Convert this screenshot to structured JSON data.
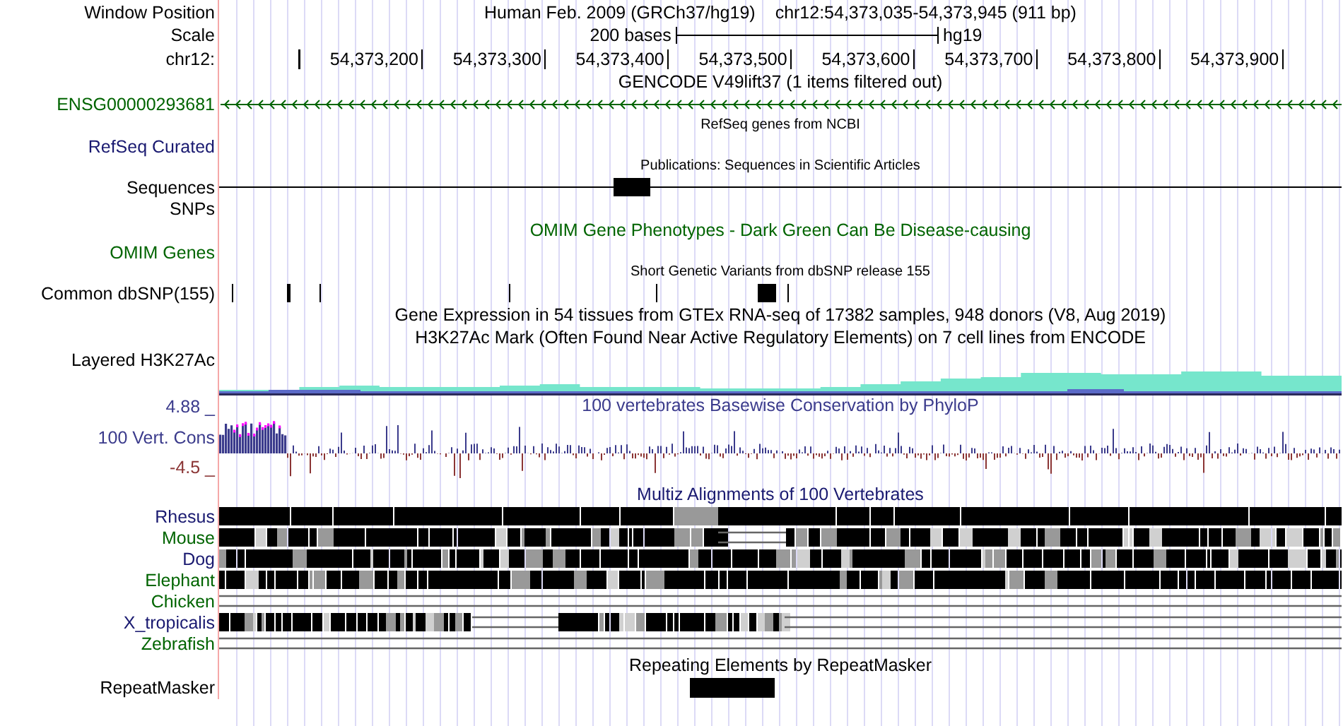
{
  "header": {
    "position_label": "Window Position",
    "title": "Human Feb. 2009 (GRCh37/hg19)",
    "position": "chr12:54,373,035-54,373,945 (911 bp)",
    "scale_label": "Scale",
    "scale_text": "200 bases",
    "assembly": "hg19",
    "ruler_label": "chr12:",
    "ruler_ticks": [
      "54,373,200",
      "54,373,300",
      "54,373,400",
      "54,373,500",
      "54,373,600",
      "54,373,700",
      "54,373,800",
      "54,373,900"
    ]
  },
  "rows": [
    {
      "kind": "caption",
      "text": "GENCODE V49lift37 (1 items filtered out)",
      "color": "#000000"
    },
    {
      "kind": "gene",
      "label": "ENSG00000293681",
      "color": "#006400"
    },
    {
      "kind": "note",
      "text": "RefSeq genes from NCBI"
    },
    {
      "kind": "empty",
      "label": "RefSeq Curated",
      "color": "#191970"
    },
    {
      "kind": "note",
      "text": "Publications: Sequences in Scientific Articles"
    },
    {
      "kind": "sequence",
      "label": "Sequences",
      "color": "#000000"
    },
    {
      "kind": "empty",
      "label": "SNPs",
      "color": "#000000"
    },
    {
      "kind": "caption",
      "text": "OMIM Gene Phenotypes - Dark Green Can Be Disease-causing",
      "color": "#006400"
    },
    {
      "kind": "empty",
      "label": "OMIM Genes",
      "color": "#006400"
    },
    {
      "kind": "note",
      "text": "Short Genetic Variants from dbSNP release 155"
    },
    {
      "kind": "snps",
      "label": "Common dbSNP(155)",
      "color": "#000000"
    },
    {
      "kind": "caption",
      "text": "Gene Expression in 54 tissues from GTEx RNA-seq of 17382 samples, 948 donors (V8, Aug 2019)",
      "color": "#000000"
    },
    {
      "kind": "caption",
      "text": "H3K27Ac Mark (Often Found Near Active Regulatory Elements) on 7 cell lines from ENCODE",
      "color": "#000000"
    },
    {
      "kind": "empty",
      "label": "Layered H3K27Ac",
      "color": "#000000"
    },
    {
      "kind": "layered"
    },
    {
      "kind": "conservation",
      "top": "4.88 _",
      "label": "100 Vert. Cons",
      "bottom": "-4.5 _",
      "text": "100 vertebrates Basewise Conservation by PhyloP"
    },
    {
      "kind": "caption",
      "text": "Multiz Alignments of 100 Vertebrates",
      "color": "#191970"
    },
    {
      "kind": "alignment",
      "label": "Rhesus",
      "color": "#191970"
    },
    {
      "kind": "alignment",
      "label": "Mouse",
      "color": "#006400"
    },
    {
      "kind": "alignment",
      "label": "Dog",
      "color": "#191970"
    },
    {
      "kind": "alignment",
      "label": "Elephant",
      "color": "#006400"
    },
    {
      "kind": "gap",
      "label": "Chicken",
      "color": "#006400"
    },
    {
      "kind": "alignment",
      "label": "X_tropicalis",
      "color": "#191970"
    },
    {
      "kind": "gap",
      "label": "Zebrafish",
      "color": "#006400"
    },
    {
      "kind": "caption",
      "text": "Repeating Elements by RepeatMasker",
      "color": "#000000"
    },
    {
      "kind": "repeat",
      "label": "RepeatMasker",
      "color": "#000000"
    }
  ]
}
